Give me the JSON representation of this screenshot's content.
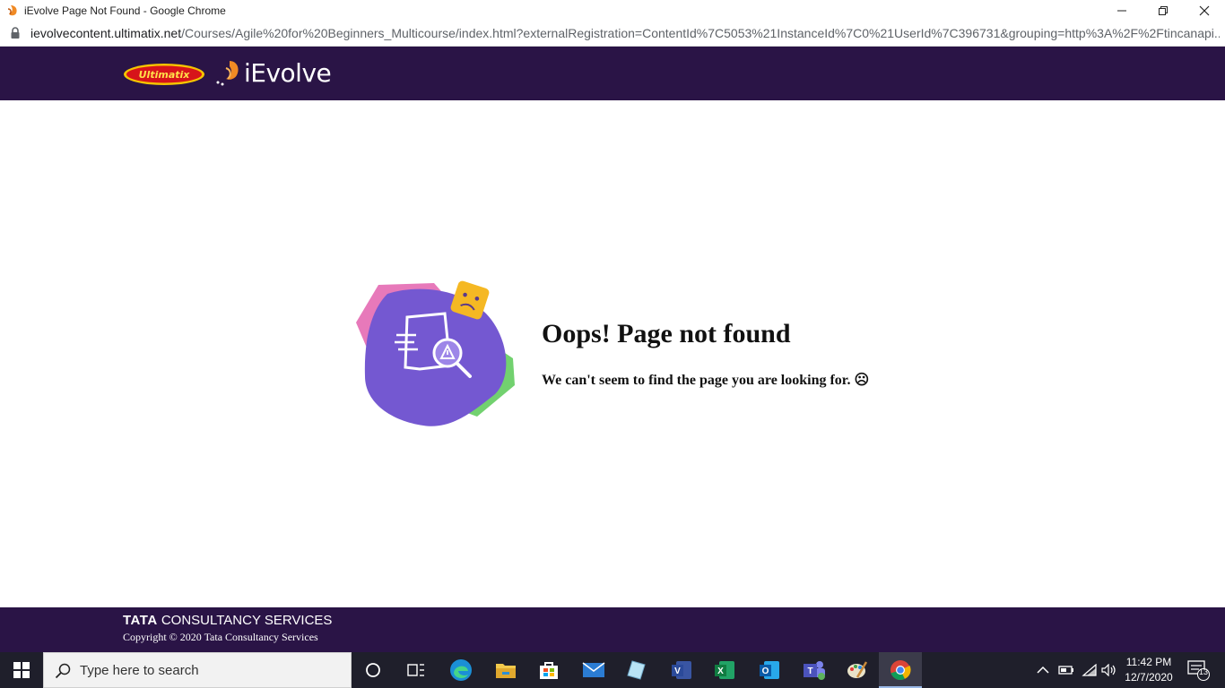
{
  "browser": {
    "window_title": "iEvolve Page Not Found - Google Chrome",
    "url_host": "ievolvecontent.ultimatix.net",
    "url_path": "/Courses/Agile%20for%20Beginners_Multicourse/index.html?externalRegistration=ContentId%7C5053%21InstanceId%7C0%21UserId%7C396731&grouping=http%3A%2F%2Ftincanapi...",
    "controls": [
      "minimize-icon",
      "restore-icon",
      "close-icon"
    ]
  },
  "header": {
    "ultimatix_logo": "Ultimatix",
    "ievolve_logo": "iEvolve"
  },
  "main": {
    "heading": "Oops! Page not found",
    "subtext": "We can't seem to find the page you are looking for. ☹"
  },
  "footer": {
    "brand_tata": "TATA",
    "brand_rest": "CONSULTANCY SERVICES",
    "copyright": "Copyright © 2020 Tata Consultancy Services"
  },
  "taskbar": {
    "search_placeholder": "Type here to search",
    "time": "11:42 PM",
    "date": "12/7/2020",
    "notification_count": "13",
    "apps": [
      "cortana-icon",
      "task-view-icon",
      "edge-icon",
      "file-explorer-icon",
      "store-icon",
      "mail-icon",
      "notepad-icon",
      "visio-icon",
      "excel-icon",
      "outlook-icon",
      "teams-icon",
      "paint-icon",
      "chrome-icon"
    ]
  },
  "colors": {
    "header_bg": "#2a1446",
    "illustration_purple": "#7b5fd6",
    "illustration_pink": "#e05fa8",
    "illustration_green": "#7ad67f",
    "emoji_yellow": "#f5b823"
  }
}
